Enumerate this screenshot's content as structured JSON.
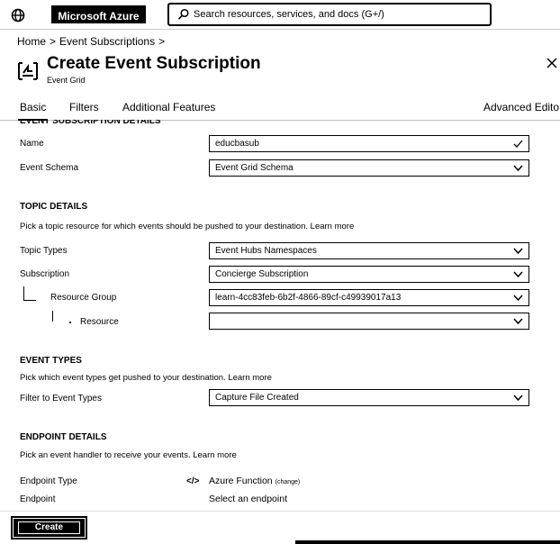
{
  "topbar": {
    "brand": "Microsoft Azure",
    "search_placeholder": "Search resources, services, and docs (G+/)",
    "menu_icon": "globe-grid-icon",
    "search_icon": "search-icon"
  },
  "breadcrumb": {
    "items": [
      "Home",
      ">",
      "Event Subscriptions",
      ">"
    ]
  },
  "page": {
    "title": "Create Event Subscription",
    "subtitle": "Event Grid",
    "title_icon": "event-grid-icon",
    "close_icon": "close-icon"
  },
  "tabs": [
    {
      "label": "Basic",
      "active": true
    },
    {
      "label": "Filters",
      "active": false
    },
    {
      "label": "Additional Features",
      "active": false
    },
    {
      "label": "Advanced Edito",
      "active": false
    }
  ],
  "event_subscription_details": {
    "header": "EVENT SUBSCRIPTION DETAILS",
    "name_label": "Name",
    "name_value": "educbasub",
    "schema_label": "Event Schema",
    "schema_value": "Event Grid Schema"
  },
  "topic_details": {
    "header": "TOPIC DETAILS",
    "description": "Pick a topic resource for which events should be pushed to your destination.",
    "learn_more": "Learn more",
    "topic_types_label": "Topic Types",
    "topic_types_value": "Event Hubs Namespaces",
    "subscription_label": "Subscription",
    "subscription_value": "Concierge Subscription",
    "resource_group_label": "Resource Group",
    "resource_group_value": "learn-4cc83feb-6b2f-4866-89cf-c49939017a13",
    "resource_label": "Resource",
    "resource_value": ""
  },
  "event_types": {
    "header": "EVENT TYPES",
    "description": "Pick which event types get pushed to your destination.",
    "learn_more": "Learn more",
    "filter_label": "Filter to Event Types",
    "filter_value": "Capture File Created"
  },
  "endpoint_details": {
    "header": "ENDPOINT DETAILS",
    "description": "Pick an event handler to receive your events.",
    "learn_more": "Learn more",
    "endpoint_type_label": "Endpoint Type",
    "endpoint_type_icon": "</>",
    "endpoint_type_value": "Azure Function",
    "change_label": "(change)",
    "endpoint_label": "Endpoint",
    "endpoint_value": "Select an endpoint"
  },
  "footer": {
    "create_label": "Create"
  }
}
